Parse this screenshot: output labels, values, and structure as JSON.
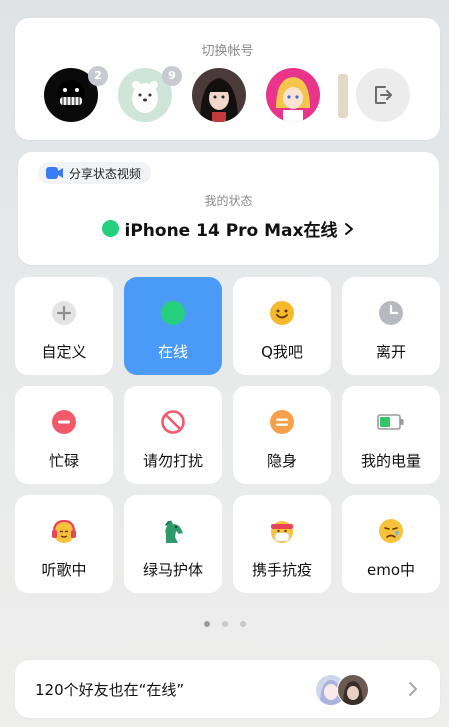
{
  "account_switcher": {
    "title": "切换帐号",
    "accounts": [
      {
        "name": "account-1",
        "badge": "2"
      },
      {
        "name": "account-2",
        "badge": "9"
      },
      {
        "name": "account-3",
        "badge": ""
      },
      {
        "name": "account-4",
        "badge": ""
      }
    ],
    "logout_icon": "logout-icon"
  },
  "status": {
    "share_label": "分享状态视频",
    "caption": "我的状态",
    "current": "iPhone 14 Pro Max在线",
    "online_color": "#24d07c"
  },
  "tiles": [
    {
      "label": "自定义",
      "icon": "plus-icon"
    },
    {
      "label": "在线",
      "icon": "online-dot-icon",
      "active": true
    },
    {
      "label": "Q我吧",
      "icon": "smile-icon"
    },
    {
      "label": "离开",
      "icon": "clock-icon"
    },
    {
      "label": "忙碌",
      "icon": "busy-icon"
    },
    {
      "label": "请勿打扰",
      "icon": "no-entry-icon"
    },
    {
      "label": "隐身",
      "icon": "invisible-icon"
    },
    {
      "label": "我的电量",
      "icon": "battery-icon"
    },
    {
      "label": "听歌中",
      "icon": "headphones-icon"
    },
    {
      "label": "绿马护体",
      "icon": "green-horse-icon"
    },
    {
      "label": "携手抗疫",
      "icon": "mask-icon"
    },
    {
      "label": "emo中",
      "icon": "sad-icon"
    }
  ],
  "pager": {
    "current": 1,
    "total": 3
  },
  "friends_bar": {
    "text": "120个好友也在“在线”"
  },
  "colors": {
    "accent": "#4a9bf8",
    "online": "#24d07c"
  }
}
